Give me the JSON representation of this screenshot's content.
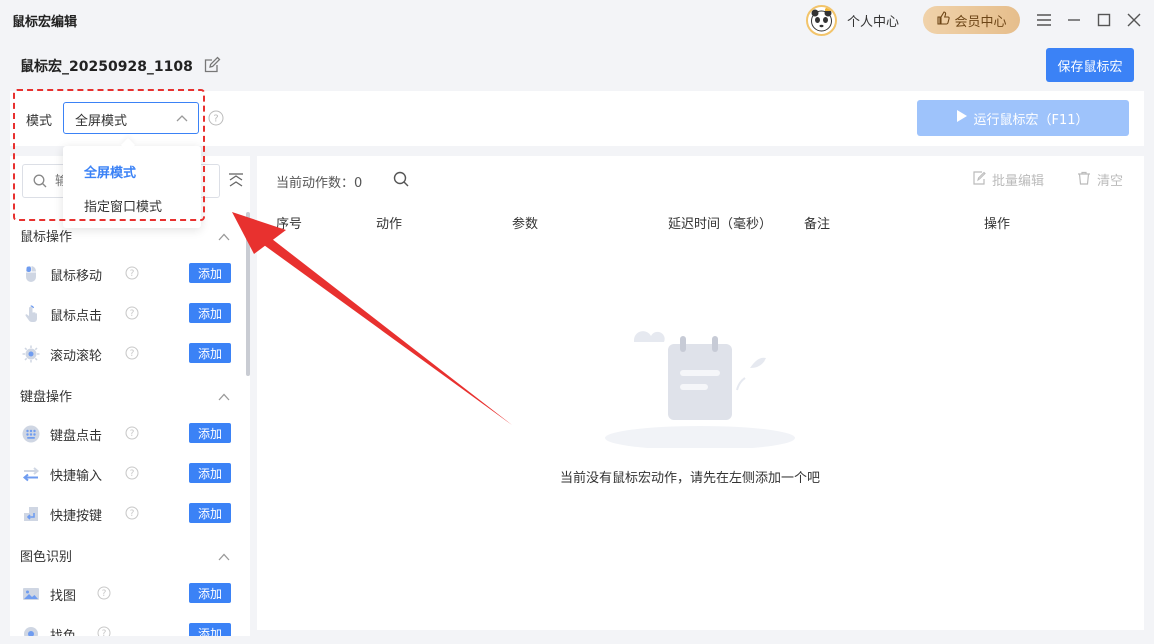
{
  "window": {
    "title": "鼠标宏编辑",
    "personal_center": "个人中心",
    "vip_center": "会员中心"
  },
  "header": {
    "macro_name": "鼠标宏_20250928_1108",
    "save_label": "保存鼠标宏"
  },
  "mode": {
    "label": "模式",
    "selected": "全屏模式",
    "options": [
      "全屏模式",
      "指定窗口模式"
    ],
    "run_label": "运行鼠标宏（F11）"
  },
  "left": {
    "search_placeholder": "输入",
    "groups": [
      {
        "title": "鼠标操作",
        "items": [
          {
            "label": "鼠标移动",
            "add": "添加"
          },
          {
            "label": "鼠标点击",
            "add": "添加"
          },
          {
            "label": "滚动滚轮",
            "add": "添加"
          }
        ]
      },
      {
        "title": "键盘操作",
        "items": [
          {
            "label": "键盘点击",
            "add": "添加"
          },
          {
            "label": "快捷输入",
            "add": "添加"
          },
          {
            "label": "快捷按键",
            "add": "添加"
          }
        ]
      },
      {
        "title": "图色识别",
        "items": [
          {
            "label": "找图",
            "add": "添加"
          },
          {
            "label": "找色",
            "add": "添加"
          }
        ]
      }
    ]
  },
  "right": {
    "count_label": "当前动作数：",
    "count": "0",
    "batch_edit": "批量编辑",
    "clear": "清空",
    "columns": [
      "序号",
      "动作",
      "参数",
      "延迟时间（毫秒）",
      "备注",
      "操作"
    ],
    "empty_text": "当前没有鼠标宏动作，请先在左侧添加一个吧"
  },
  "colors": {
    "accent": "#3b82f6",
    "annotation_red": "#e8312f"
  }
}
